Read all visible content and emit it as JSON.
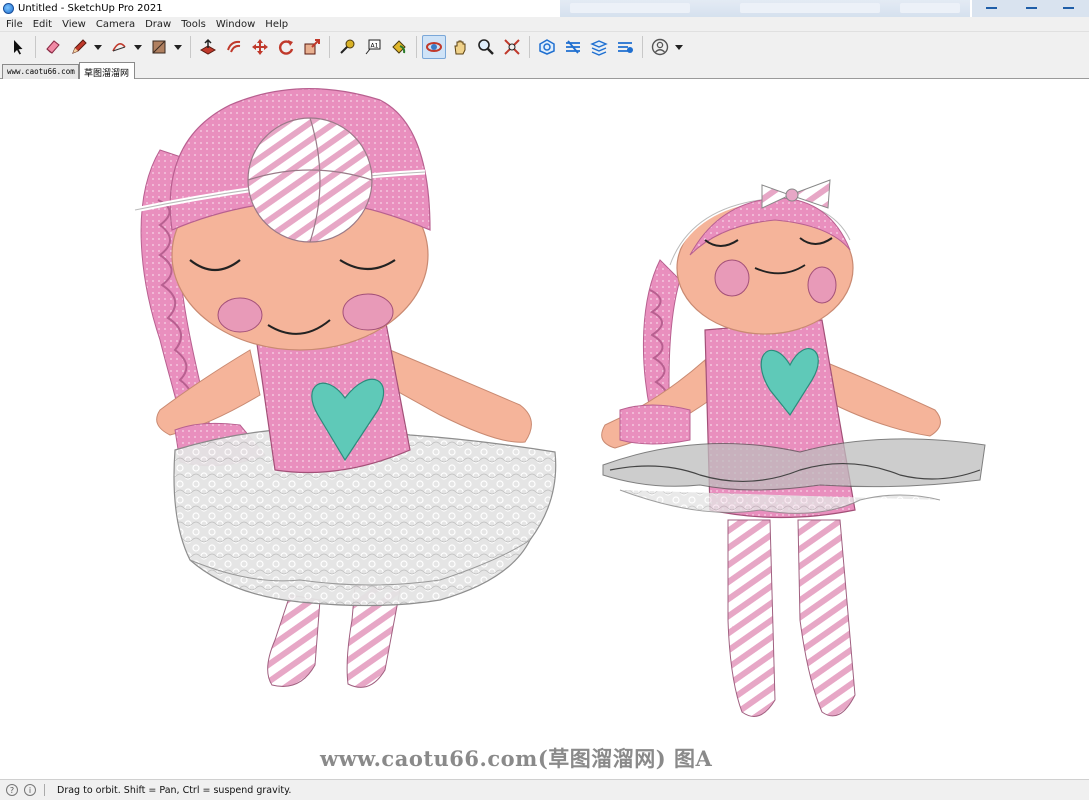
{
  "window": {
    "title": "Untitled - SketchUp Pro 2021"
  },
  "menu": [
    "File",
    "Edit",
    "View",
    "Camera",
    "Draw",
    "Tools",
    "Window",
    "Help"
  ],
  "toolbar": {
    "tools": [
      {
        "name": "select-icon"
      },
      {
        "name": "eraser-icon"
      },
      {
        "name": "pencil-line-icon",
        "dropdown": true
      },
      {
        "name": "arc-icon",
        "dropdown": true
      },
      {
        "name": "rectangle-icon",
        "dropdown": true
      },
      {
        "name": "push-pull-icon"
      },
      {
        "name": "offset-icon"
      },
      {
        "name": "move-icon"
      },
      {
        "name": "rotate-icon"
      },
      {
        "name": "scale-icon"
      },
      {
        "name": "tape-measure-icon"
      },
      {
        "name": "text-icon"
      },
      {
        "name": "paint-bucket-icon"
      },
      {
        "name": "orbit-icon",
        "active": true
      },
      {
        "name": "pan-icon"
      },
      {
        "name": "zoom-icon"
      },
      {
        "name": "zoom-extents-icon"
      },
      {
        "name": "warehouse-icon"
      },
      {
        "name": "extension-warehouse-icon"
      },
      {
        "name": "layout-icon"
      },
      {
        "name": "extension-manager-icon"
      },
      {
        "name": "account-icon",
        "dropdown": true
      }
    ]
  },
  "scene_tabs": [
    "www.caotu66.com",
    "草图溜溜网"
  ],
  "viewport": {
    "watermark": "www.caotu66.com(草图溜溜网) 图A",
    "colors": {
      "pink": "#e88fbd",
      "skin": "#f5b49a",
      "teal": "#5fc9b8",
      "lace": "#d9d9d9"
    }
  },
  "status": {
    "text": "Drag to orbit. Shift = Pan, Ctrl = suspend gravity."
  }
}
